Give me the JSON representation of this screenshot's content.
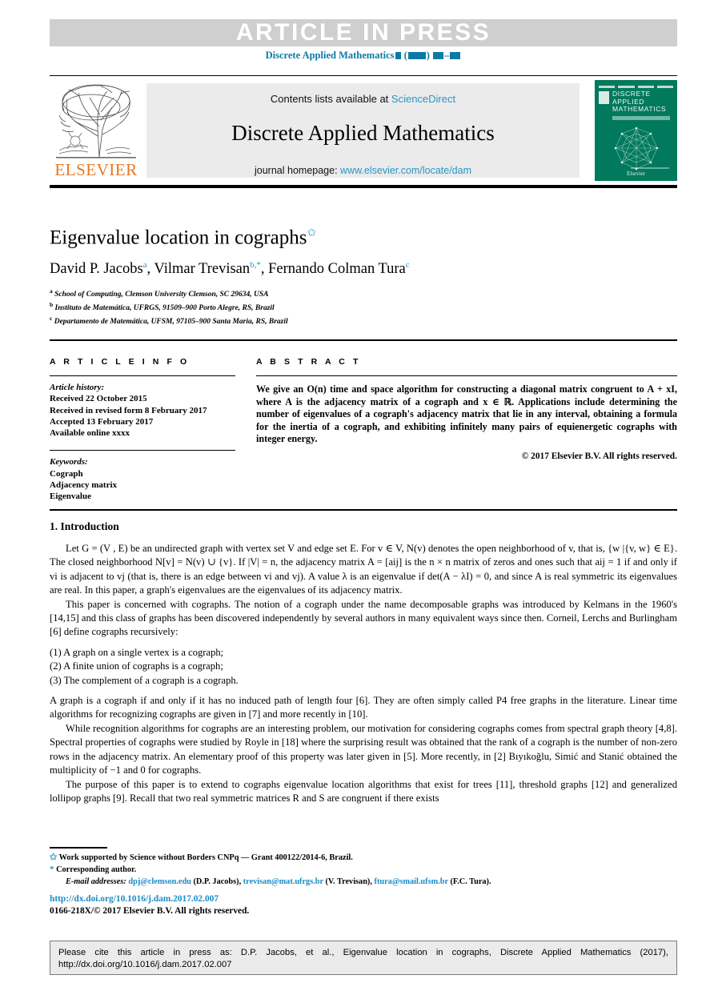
{
  "banner": {
    "text": "ARTICLE  IN  PRESS",
    "journal_ref_prefix": "Discrete Applied Mathematics",
    "accent_color": "#0b7ba5"
  },
  "masthead": {
    "elsevier_wordmark": "ELSEVIER",
    "contents_prefix": "Contents lists available at ",
    "contents_link": "ScienceDirect",
    "journal_title": "Discrete Applied Mathematics",
    "homepage_prefix": "journal homepage: ",
    "homepage_link": "www.elsevier.com/locate/dam",
    "cover": {
      "line1": "DISCRETE",
      "line2": "APPLIED",
      "line3": "MATHEMATICS",
      "publisher": "Elsevier",
      "background_color": "#00795d"
    },
    "link_color": "#2a95c5"
  },
  "article": {
    "title": "Eigenvalue location in cographs",
    "title_footnote_mark": "✩",
    "authors": [
      {
        "name": "David P. Jacobs",
        "marks": "a"
      },
      {
        "name": "Vilmar Trevisan",
        "marks": "b,*"
      },
      {
        "name": "Fernando Colman Tura",
        "marks": "c"
      }
    ],
    "affiliations": [
      {
        "mark": "a",
        "text": "School of Computing, Clemson University Clemson, SC 29634, USA"
      },
      {
        "mark": "b",
        "text": "Instituto de Matemática, UFRGS, 91509–900 Porto Alegre, RS, Brazil"
      },
      {
        "mark": "c",
        "text": "Departamento de Matemática, UFSM, 97105–900 Santa Maria, RS, Brazil"
      }
    ]
  },
  "article_info": {
    "heading": "A R T I C L E   I N F O",
    "history_label": "Article history:",
    "history": [
      "Received 22 October 2015",
      "Received in revised form 8 February 2017",
      "Accepted 13 February 2017",
      "Available online xxxx"
    ],
    "keywords_label": "Keywords:",
    "keywords": [
      "Cograph",
      "Adjacency matrix",
      "Eigenvalue"
    ]
  },
  "abstract": {
    "heading": "A B S T R A C T",
    "text": "We give an O(n) time and space algorithm for constructing a diagonal matrix congruent to A + xI, where A is the adjacency matrix of a cograph and x ∈ ℝ. Applications include determining the number of eigenvalues of a cograph's adjacency matrix that lie in any interval, obtaining a formula for the inertia of a cograph, and exhibiting infinitely many pairs of equienergetic cographs with integer energy.",
    "copyright": "© 2017 Elsevier B.V. All rights reserved."
  },
  "body": {
    "section_heading": "1.  Introduction",
    "paragraph1": "Let G = (V , E) be an undirected graph with vertex set V and edge set E. For v ∈ V, N(v) denotes the open neighborhood of v, that is, {w |{v, w} ∈ E}. The closed neighborhood N[v] = N(v) ∪ {v}. If |V| = n, the adjacency matrix A = [aij] is the n × n matrix of zeros and ones such that aij = 1 if and only if vi is adjacent to vj (that is, there is an edge between vi and vj). A value λ is an eigenvalue if det(A − λI) = 0, and since A is real symmetric its eigenvalues are real. In this paper, a graph's eigenvalues are the eigenvalues of its adjacency matrix.",
    "paragraph2": "This paper is concerned with cographs. The notion of a cograph under the name decomposable graphs was introduced by Kelmans in the 1960's [14,15] and this class of graphs has been discovered independently by several authors in many equivalent ways since then. Corneil, Lerchs and Burlingham [6] define cographs recursively:",
    "list": [
      "(1)  A graph on a single vertex is a cograph;",
      "(2)  A finite union of cographs is a cograph;",
      "(3)  The complement of a cograph is a cograph."
    ],
    "paragraph3": "A graph is a cograph if and only if it has no induced path of length four [6]. They are often simply called P4 free graphs in the literature. Linear time algorithms for recognizing cographs are given in [7] and more recently in [10].",
    "paragraph4": "While recognition algorithms for cographs are an interesting problem, our motivation for considering cographs comes from spectral graph theory [4,8]. Spectral properties of cographs were studied by Royle in [18] where the surprising result was obtained that the rank of a cograph is the number of non-zero rows in the adjacency matrix. An elementary proof of this property was later given in [5]. More recently, in [2] Bıyıkoğlu, Simić and Stanić obtained the multiplicity of −1 and 0 for cographs.",
    "paragraph5": "The purpose of this paper is to extend to cographs eigenvalue location algorithms that exist for trees [11], threshold graphs [12] and generalized lollipop graphs [9]. Recall that two real symmetric matrices R and S are congruent if there exists"
  },
  "footnotes": {
    "funding_mark": "✩",
    "funding": "Work supported by Science without Borders CNPq — Grant 400122/2014-6, Brazil.",
    "corresponding_mark": "*",
    "corresponding": "Corresponding author.",
    "email_label": "E-mail addresses:",
    "emails": [
      {
        "address": "dpj@clemson.edu",
        "person": "(D.P. Jacobs),"
      },
      {
        "address": "trevisan@mat.ufrgs.br",
        "person": "(V. Trevisan),"
      },
      {
        "address": "ftura@smail.ufsm.br",
        "person": "(F.C. Tura)."
      }
    ],
    "doi": "http://dx.doi.org/10.1016/j.dam.2017.02.007",
    "issn_line": "0166-218X/© 2017 Elsevier B.V. All rights reserved.",
    "link_color": "#1a8bc4"
  },
  "citation_box": {
    "line1": "Please cite this article in press as: D.P. Jacobs, et al., Eigenvalue location in cographs, Discrete Applied Mathematics (2017),",
    "line2": "http://dx.doi.org/10.1016/j.dam.2017.02.007"
  }
}
